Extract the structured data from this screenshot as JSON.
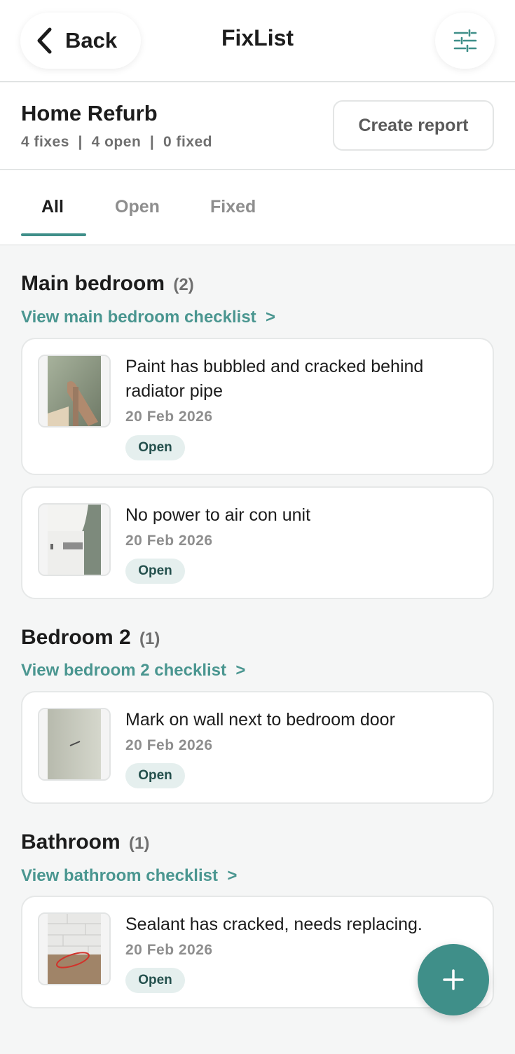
{
  "header": {
    "back_label": "Back",
    "app_title": "FixList",
    "back_icon": "chevron-left-icon",
    "filter_icon": "sliders-icon"
  },
  "project": {
    "name": "Home Refurb",
    "stats": "4 fixes  |  4 open  |  0 fixed",
    "create_report_label": "Create report"
  },
  "tabs": [
    {
      "label": "All",
      "active": true
    },
    {
      "label": "Open",
      "active": false
    },
    {
      "label": "Fixed",
      "active": false
    }
  ],
  "sections": [
    {
      "title": "Main bedroom",
      "count": "(2)",
      "link": "View main bedroom checklist  >",
      "items": [
        {
          "title": "Paint has bubbled and cracked behind radiator pipe",
          "date": "20 Feb 2026",
          "status": "Open"
        },
        {
          "title": "No power to air con unit",
          "date": "20 Feb 2026",
          "status": "Open"
        }
      ]
    },
    {
      "title": "Bedroom 2",
      "count": "(1)",
      "link": "View bedroom 2 checklist  >",
      "items": [
        {
          "title": "Mark on wall next to bedroom door",
          "date": "20 Feb 2026",
          "status": "Open"
        }
      ]
    },
    {
      "title": "Bathroom",
      "count": "(1)",
      "link": "View bathroom checklist  >",
      "items": [
        {
          "title": "Sealant has cracked, needs replacing.",
          "date": "20 Feb 2026",
          "status": "Open"
        }
      ]
    }
  ],
  "fab_icon": "plus-icon",
  "colors": {
    "accent": "#3f8f89",
    "badge_bg": "#e5efee",
    "badge_text": "#24504d",
    "link": "#4a9690"
  }
}
